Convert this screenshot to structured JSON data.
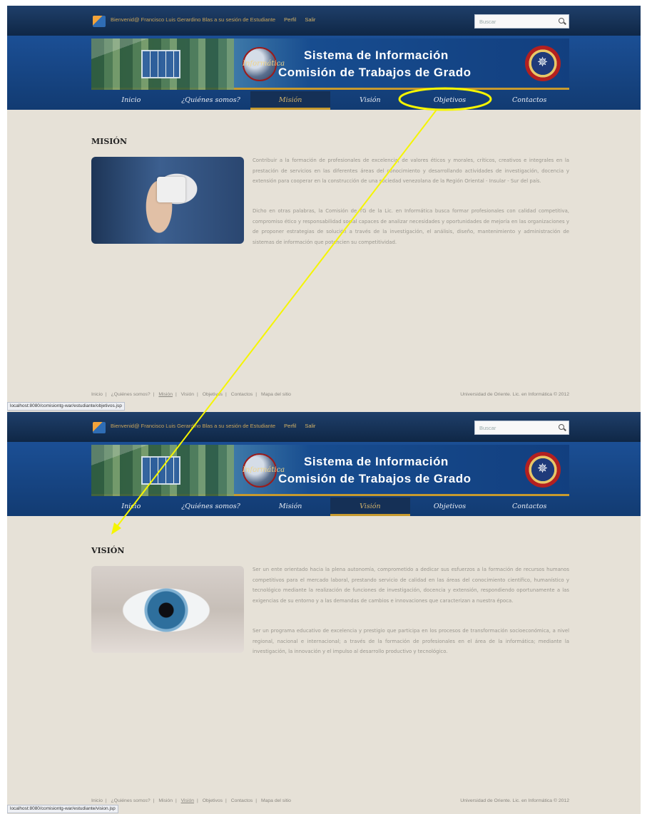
{
  "header": {
    "welcome": "Bienvenid@ Francisco Luis Gerardino Blas a su sesión de Estudiante",
    "profile": "Perfil",
    "logout": "Salir",
    "search_placeholder": "Buscar"
  },
  "banner": {
    "logo_text": "Informática",
    "title_line1": "Sistema de Información",
    "title_line2": "Comisión de Trabajos de Grado"
  },
  "nav": [
    "Inicio",
    "¿Quiénes somos?",
    "Misión",
    "Visión",
    "Objetivos",
    "Contactos"
  ],
  "screens": [
    {
      "active_nav": "Misión",
      "heading": "MISIÓN",
      "paragraphs": [
        "Contribuir a la formación de profesionales de excelencia, de valores éticos y morales, críticos, creativos e integrales en la prestación de servicios en las diferentes áreas del conocimiento y desarrollando actividades de investigación, docencia y extensión para cooperar en la construcción de una sociedad venezolana de la Región Oriental - Insular - Sur del país.",
        "Dicho en otras palabras, la Comisión de TG de la Lic. en Informática busca formar profesionales con calidad competitiva, compromiso ético y responsabilidad social capaces de analizar necesidades y oportunidades de mejoría en las organizaciones y de proponer estrategias de solución a través de la investigación, el análisis, diseño, mantenimiento y administración de sistemas de información que potencien su competitividad."
      ],
      "status_url": "localhost:8080/comisiontg-war/estudiante/objetivos.jsp"
    },
    {
      "active_nav": "Visión",
      "heading": "VISIÓN",
      "paragraphs": [
        "Ser un ente orientado hacia la plena autonomía, comprometido a dedicar sus esfuerzos a la formación de recursos humanos competitivos para el mercado laboral, prestando servicio de calidad en las áreas del conocimiento científico, humanístico y tecnológico mediante la realización de funciones de investigación, docencia y extensión, respondiendo oportunamente a las exigencias de su entorno y a las demandas de cambios e innovaciones que caracterizan a nuestra época.",
        "Ser un programa educativo de excelencia y prestigio que participa en los procesos de transformación socioeconómica, a nivel regional, nacional e internacional; a través de la formación de profesionales en el área de la informática; mediante la investigación, la innovación y el impulso al desarrollo productivo y tecnológico."
      ],
      "status_url": "localhost:8080/comisiontg-war/estudiante/vision.jsp"
    }
  ],
  "footer": {
    "links": [
      "Inicio",
      "¿Quiénes somos?",
      "Misión",
      "Visión",
      "Objetivos",
      "Contactos",
      "Mapa del sitio"
    ],
    "copyright": "Universidad de Oriente. Lic. en Informática © 2012"
  },
  "annotation": {
    "color": "#f5f500"
  }
}
